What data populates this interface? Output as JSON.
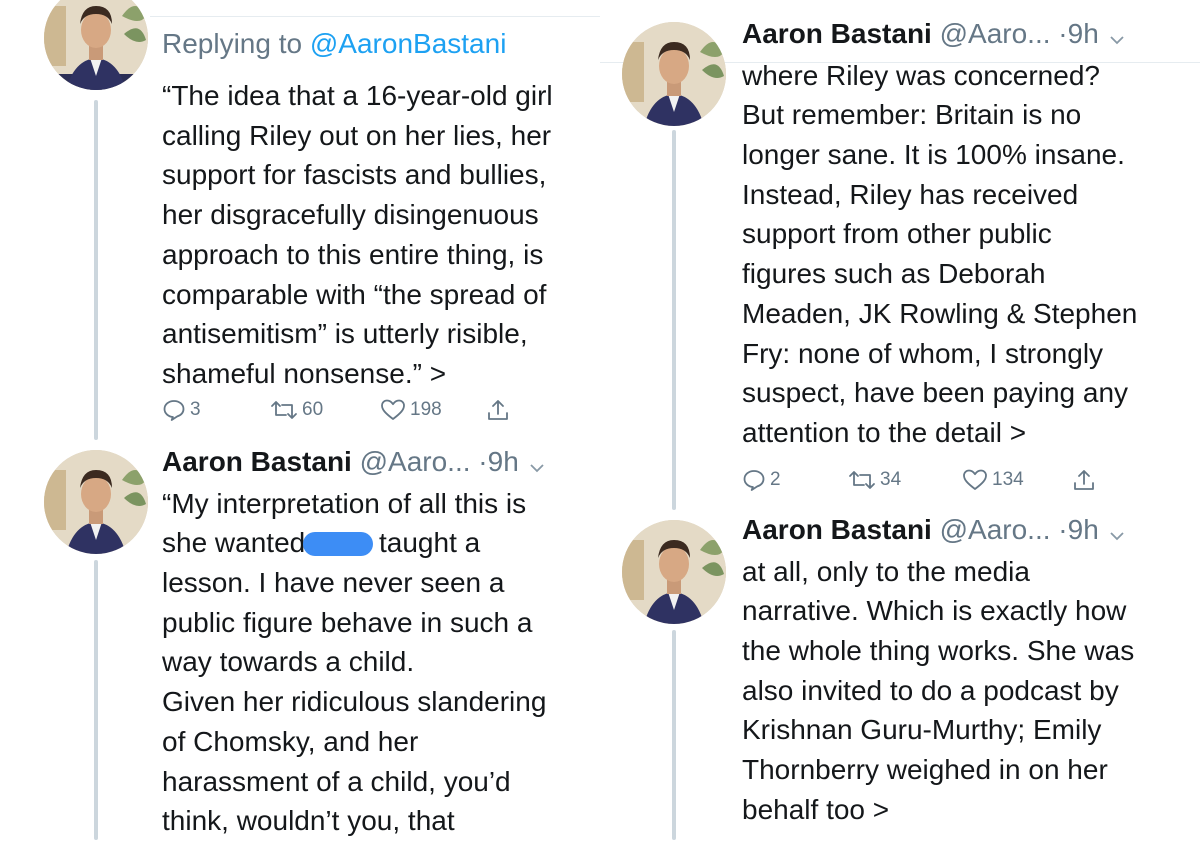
{
  "left": {
    "tweet1": {
      "replying_prefix": "Replying to ",
      "replying_mention": "@AaronBastani",
      "body": [
        "“The idea that a 16-year-old girl",
        "calling Riley out on her lies, her",
        "support for fascists and bullies,",
        "her disgracefully disingenuous",
        "approach to this entire thing, is",
        "comparable with “the spread of",
        "antisemitism” is utterly risible,",
        "shameful nonsense.” >"
      ],
      "stats": {
        "replies": "3",
        "retweets": "60",
        "likes": "198"
      }
    },
    "tweet2": {
      "name": "Aaron Bastani",
      "handle": " @Aaro...",
      "time": " ·9h",
      "body_line1": "“My interpretation of all this is",
      "body_line2_before": "she wanted",
      "body_line2_after": "taught a",
      "body_rest": [
        "lesson. I have never seen a",
        "public figure behave in such a",
        "way towards a child.",
        "Given her ridiculous slandering",
        "of Chomsky, and her",
        "harassment of a child, you’d",
        "think, wouldn’t you, that"
      ]
    }
  },
  "right": {
    "tweet1": {
      "name": "Aaron Bastani",
      "handle": " @Aaro...",
      "time": " ·9h",
      "body": [
        "where Riley was concerned?",
        "But remember: Britain is no",
        "longer sane. It is 100% insane.",
        "Instead, Riley has received",
        "support from other public",
        "figures such as Deborah",
        "Meaden, JK Rowling & Stephen",
        "Fry: none of whom, I strongly",
        "suspect, have been paying any",
        "attention to the detail >"
      ],
      "stats": {
        "replies": "2",
        "retweets": "34",
        "likes": "134"
      }
    },
    "tweet2": {
      "name": "Aaron Bastani",
      "handle": " @Aaro...",
      "time": " ·9h",
      "body": [
        "at all, only to the media",
        "narrative. Which is exactly how",
        "the whole thing works. She was",
        "also invited to do a podcast by",
        "Krishnan Guru-Murthy; Emily",
        "Thornberry weighed in on her",
        "behalf too >"
      ]
    }
  },
  "icons": [
    "reply-icon",
    "retweet-icon",
    "like-icon",
    "share-icon",
    "chevron-down-icon"
  ],
  "colors": {
    "link": "#1da1f2",
    "muted": "#657786",
    "thread_line": "#ccd6dd",
    "redaction": "#3d8df5"
  }
}
